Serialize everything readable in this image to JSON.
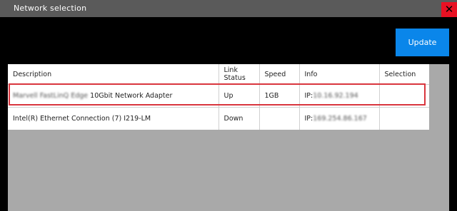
{
  "window": {
    "title": "Network selection",
    "close_label": "✕"
  },
  "update_button": {
    "label": "Update"
  },
  "table": {
    "headers": {
      "description": "Description",
      "link_status_line1": "Link",
      "link_status_line2": "Status",
      "speed": "Speed",
      "info": "Info",
      "selection": "Selection"
    },
    "rows": [
      {
        "description_prefix": "Marvell FastLinQ Edge",
        "description_suffix": " 10Gbit Network Adapter",
        "link_status": "Up",
        "speed": "1GB",
        "info_prefix": "IP:",
        "info_value": "10.16.92.194",
        "selection": ""
      },
      {
        "description_prefix": "",
        "description_suffix": "Intel(R) Ethernet Connection (7) I219-LM",
        "link_status": "Down",
        "speed": "",
        "info_prefix": "IP:",
        "info_value": "169.254.86.167",
        "selection": ""
      }
    ]
  },
  "colors": {
    "update_button": "#0a86ea",
    "highlight_outline": "#d9363e",
    "titlebar": "#5a5a5a",
    "close_button": "#e81123"
  }
}
